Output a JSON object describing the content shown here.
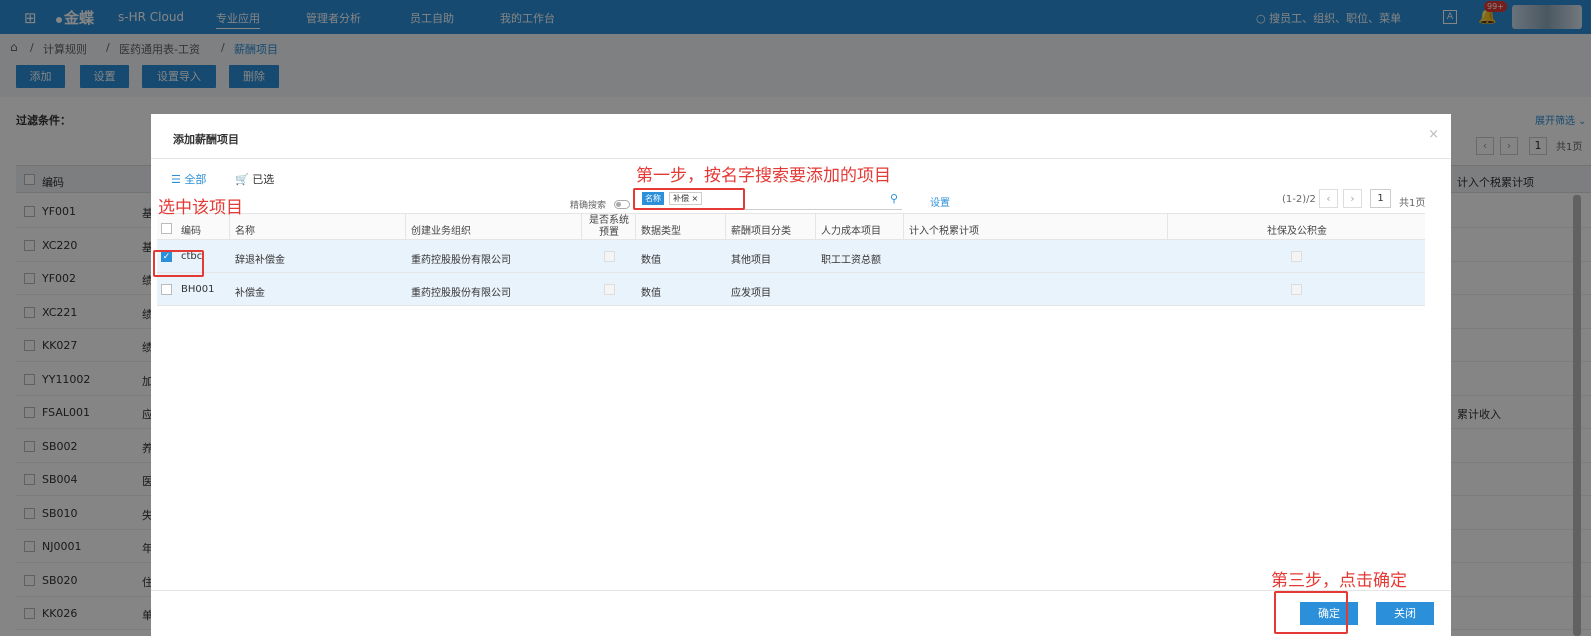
{
  "topbar": {
    "brand": "金蝶",
    "product": "s-HR Cloud",
    "nav": [
      "专业应用",
      "管理者分析",
      "员工自助",
      "我的工作台"
    ],
    "search_placeholder": "搜员工、组织、职位、菜单",
    "lang": "A",
    "notification_count": "99+"
  },
  "breadcrumb": [
    "计算规则",
    "医药通用表-工资",
    "薪酬项目"
  ],
  "toolbar": [
    "添加",
    "设置",
    "设置导入",
    "删除"
  ],
  "filter": {
    "label": "过滤条件：",
    "expand": "展开筛选"
  },
  "bg_pager": {
    "total": "共1页",
    "page": "1"
  },
  "bg_table": {
    "headers": [
      "编码",
      "计入个税累计项"
    ],
    "rows": [
      {
        "code": "YF001",
        "first": "基",
        "extra": ""
      },
      {
        "code": "XC220",
        "first": "基",
        "extra": ""
      },
      {
        "code": "YF002",
        "first": "绩",
        "extra": ""
      },
      {
        "code": "XC221",
        "first": "绩",
        "extra": ""
      },
      {
        "code": "KK027",
        "first": "绩",
        "extra": ""
      },
      {
        "code": "YY11002",
        "first": "加",
        "extra": ""
      },
      {
        "code": "FSAL001",
        "first": "应",
        "extra": "累计收入"
      },
      {
        "code": "SB002",
        "first": "养",
        "extra": ""
      },
      {
        "code": "SB004",
        "first": "医",
        "extra": ""
      },
      {
        "code": "SB010",
        "first": "失",
        "extra": ""
      },
      {
        "code": "NJ0001",
        "first": "年",
        "extra": ""
      },
      {
        "code": "SB020",
        "first": "住",
        "extra": ""
      },
      {
        "code": "KK026",
        "first": "单",
        "extra": ""
      }
    ]
  },
  "modal": {
    "title": "添加薪酬项目",
    "tabs": [
      "全部",
      "已选"
    ],
    "exact_search": "精确搜索",
    "search_chip_key": "名称",
    "search_chip_value": "补偿",
    "settings": "设置",
    "pager_range": "(1-2)/2",
    "pager_page": "1",
    "pager_total": "共1页",
    "columns": [
      "编码",
      "名称",
      "创建业务组织",
      "是否系统预置",
      "数据类型",
      "薪酬项目分类",
      "人力成本项目",
      "计入个税累计项",
      "社保及公积金"
    ],
    "rows": [
      {
        "checked": true,
        "code": "ctbc",
        "name": "辞退补偿金",
        "org": "重药控股股份有限公司",
        "type": "数值",
        "category": "其他项目",
        "cost": "职工工资总额",
        "tax": ""
      },
      {
        "checked": false,
        "code": "BH001",
        "name": "补偿金",
        "org": "重药控股股份有限公司",
        "type": "数值",
        "category": "应发项目",
        "cost": "",
        "tax": ""
      }
    ],
    "ok": "确定",
    "close": "关闭"
  },
  "annotations": {
    "step1": "第一步，按名字搜索要添加的项目",
    "step2": "选中该项目",
    "step3": "第三步，点击确定"
  },
  "colors": {
    "primary": "#2b8fd9",
    "annotation": "#e53935"
  }
}
